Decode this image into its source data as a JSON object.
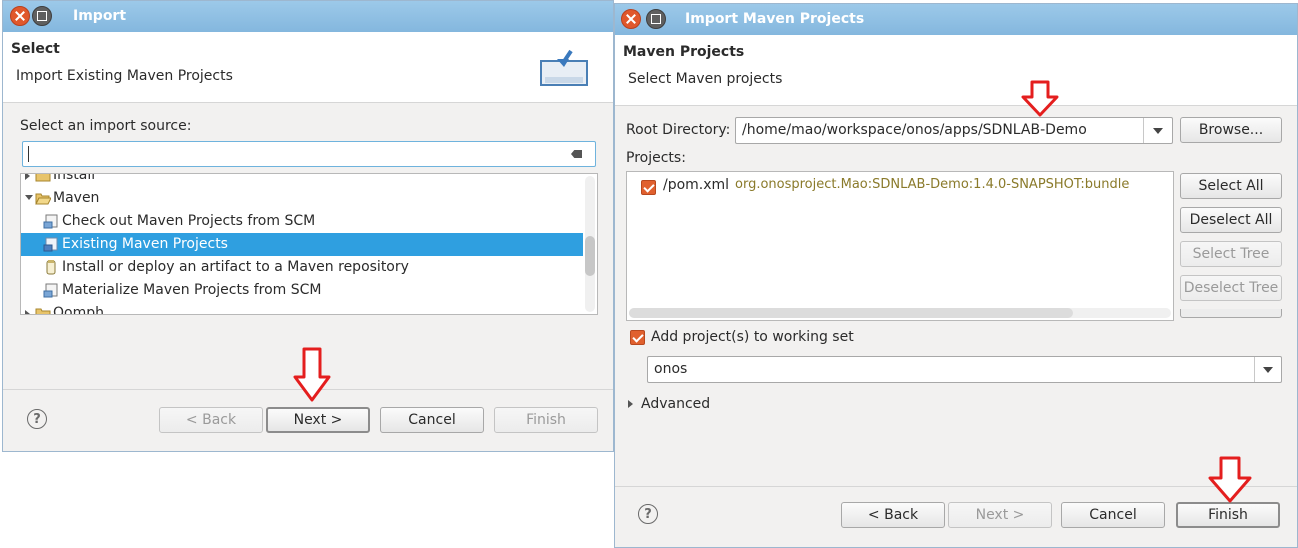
{
  "left": {
    "title": "Import",
    "heading": "Select",
    "subheading": "Import Existing Maven Projects",
    "source_label": "Select an import source:",
    "filter_value": "",
    "tree": [
      {
        "label": "Install",
        "level": 0,
        "expander": "collapsed",
        "icon": "folder-icon"
      },
      {
        "label": "Maven",
        "level": 0,
        "expander": "expanded",
        "icon": "folder-open-icon"
      },
      {
        "label": "Check out Maven Projects from SCM",
        "level": 1,
        "icon": "maven-scm-icon"
      },
      {
        "label": "Existing Maven Projects",
        "level": 1,
        "icon": "maven-project-icon",
        "selected": true
      },
      {
        "label": "Install or deploy an artifact to a Maven repository",
        "level": 1,
        "icon": "jar-icon"
      },
      {
        "label": "Materialize Maven Projects from SCM",
        "level": 1,
        "icon": "maven-scm-icon"
      },
      {
        "label": "Oomph",
        "level": 0,
        "expander": "collapsed",
        "icon": "folder-icon"
      }
    ],
    "buttons": {
      "back": "< Back",
      "next": "Next >",
      "cancel": "Cancel",
      "finish": "Finish"
    },
    "help": "?"
  },
  "right": {
    "title": "Import Maven Projects",
    "heading": "Maven Projects",
    "subheading": "Select Maven projects",
    "root_dir_label": "Root Directory:",
    "root_dir_value": "/home/mao/workspace/onos/apps/SDNLAB-Demo",
    "browse": "Browse...",
    "projects_label": "Projects:",
    "project": {
      "path": "/pom.xml",
      "artifact": "org.onosproject.Mao:SDNLAB-Demo:1.4.0-SNAPSHOT:bundle",
      "checked": true
    },
    "side_buttons": {
      "select_all": "Select All",
      "deselect_all": "Deselect All",
      "select_tree": "Select Tree",
      "deselect_tree": "Deselect Tree"
    },
    "working_set_label": "Add project(s) to working set",
    "working_set_checked": true,
    "working_set_value": "onos",
    "advanced": "Advanced",
    "buttons": {
      "back": "< Back",
      "next": "Next >",
      "cancel": "Cancel",
      "finish": "Finish"
    },
    "help": "?"
  },
  "colors": {
    "selection": "#2f9fe0",
    "arrow": "#e41e1e",
    "checkbox": "#e0602e",
    "titlebar": "#8fc0e4",
    "artifact_text": "#8a7a2a"
  }
}
